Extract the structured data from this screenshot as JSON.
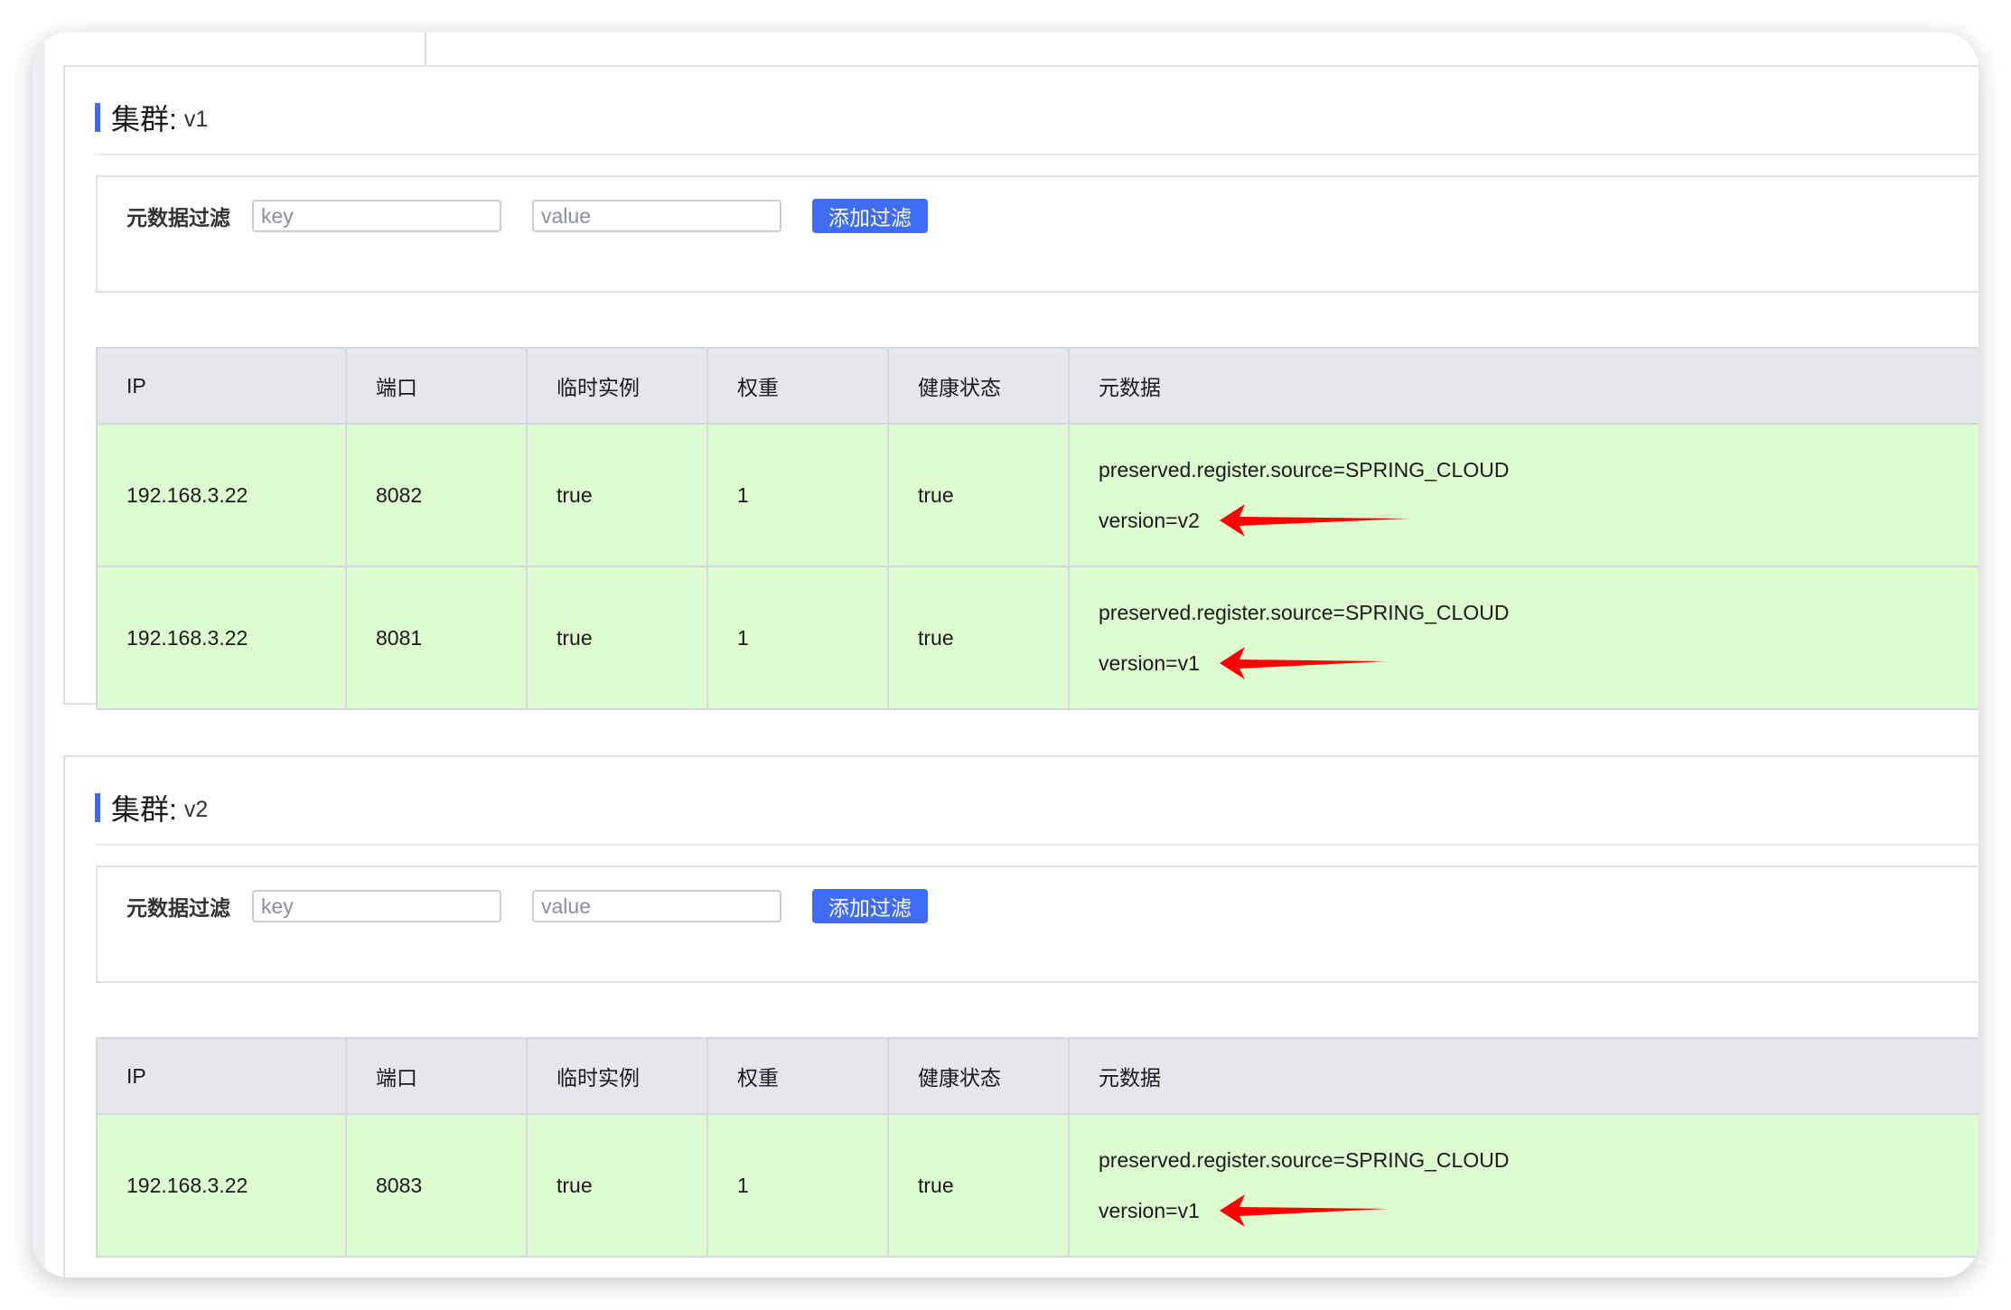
{
  "columns": [
    "IP",
    "端口",
    "临时实例",
    "权重",
    "健康状态",
    "元数据"
  ],
  "filter": {
    "label": "元数据过滤",
    "key_placeholder": "key",
    "value_placeholder": "value",
    "button_label": "添加过滤"
  },
  "clusters": [
    {
      "label": "集群:",
      "name": "v1",
      "rows": [
        {
          "ip": "192.168.3.22",
          "port": "8082",
          "ephemeral": "true",
          "weight": "1",
          "healthy": "true",
          "meta": [
            "preserved.register.source=SPRING_CLOUD",
            "version=v2"
          ]
        },
        {
          "ip": "192.168.3.22",
          "port": "8081",
          "ephemeral": "true",
          "weight": "1",
          "healthy": "true",
          "meta": [
            "preserved.register.source=SPRING_CLOUD",
            "version=v1"
          ]
        }
      ]
    },
    {
      "label": "集群:",
      "name": "v2",
      "rows": [
        {
          "ip": "192.168.3.22",
          "port": "8083",
          "ephemeral": "true",
          "weight": "1",
          "healthy": "true",
          "meta": [
            "preserved.register.source=SPRING_CLOUD",
            "version=v1"
          ]
        }
      ]
    }
  ],
  "colors": {
    "accent": "#3f6cf2",
    "row_healthy": "#ddfccf",
    "header_bg": "#e5e7ec",
    "annotation_arrow": "#ff0000"
  }
}
